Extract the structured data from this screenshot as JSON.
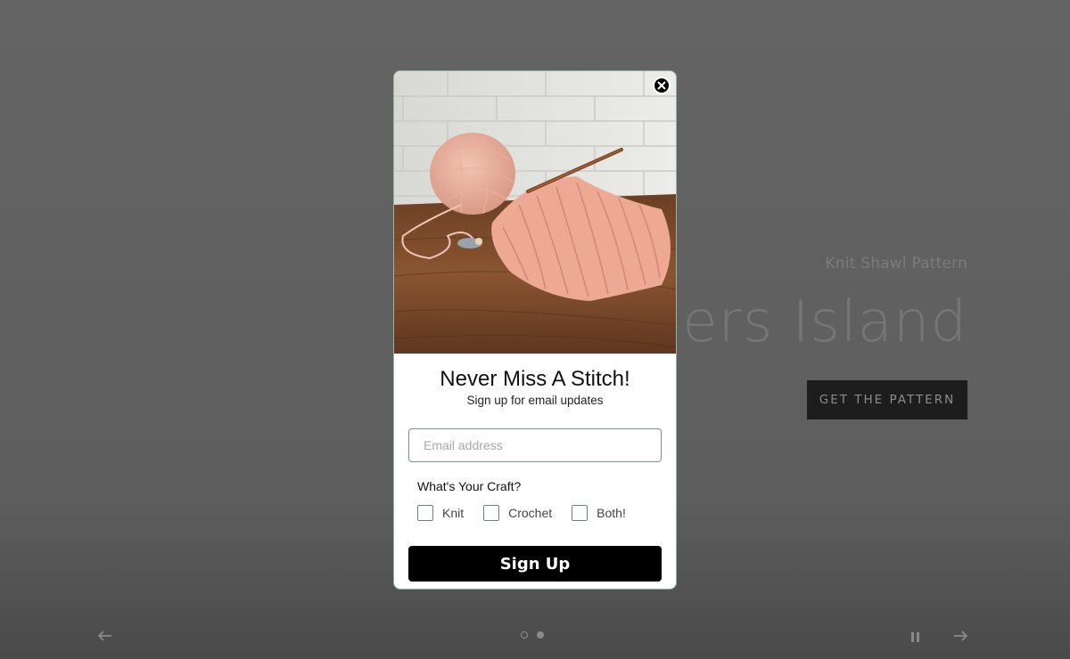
{
  "hero": {
    "subtitle": "Knit Shawl Pattern",
    "title": "Fishers Island",
    "cta_label": "GET THE PATTERN"
  },
  "carousel": {
    "prev_icon": "arrow-left-icon",
    "next_icon": "arrow-right-icon",
    "pause_icon": "pause-icon",
    "slide_count": 2,
    "active_slide": 2
  },
  "popup": {
    "title": "Never Miss A Stitch!",
    "subtitle": "Sign up for email updates",
    "email_placeholder": "Email address",
    "email_value": "",
    "craft_label": "What's Your Craft?",
    "options": [
      "Knit",
      "Crochet",
      "Both!"
    ],
    "submit_label": "Sign Up",
    "close_icon": "close-icon",
    "image": "knitting-yarn-photo",
    "border_color": "#8fb7a4",
    "button_color": "#000000"
  }
}
